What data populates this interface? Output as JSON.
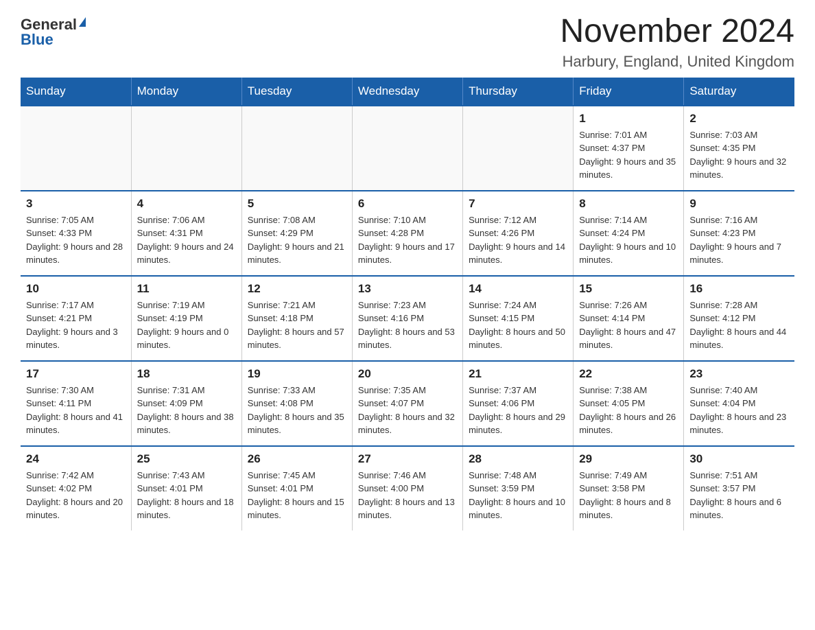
{
  "header": {
    "logo_general": "General",
    "logo_blue": "Blue",
    "month_title": "November 2024",
    "location": "Harbury, England, United Kingdom"
  },
  "weekdays": [
    "Sunday",
    "Monday",
    "Tuesday",
    "Wednesday",
    "Thursday",
    "Friday",
    "Saturday"
  ],
  "weeks": [
    [
      {
        "day": "",
        "info": ""
      },
      {
        "day": "",
        "info": ""
      },
      {
        "day": "",
        "info": ""
      },
      {
        "day": "",
        "info": ""
      },
      {
        "day": "",
        "info": ""
      },
      {
        "day": "1",
        "info": "Sunrise: 7:01 AM\nSunset: 4:37 PM\nDaylight: 9 hours and 35 minutes."
      },
      {
        "day": "2",
        "info": "Sunrise: 7:03 AM\nSunset: 4:35 PM\nDaylight: 9 hours and 32 minutes."
      }
    ],
    [
      {
        "day": "3",
        "info": "Sunrise: 7:05 AM\nSunset: 4:33 PM\nDaylight: 9 hours and 28 minutes."
      },
      {
        "day": "4",
        "info": "Sunrise: 7:06 AM\nSunset: 4:31 PM\nDaylight: 9 hours and 24 minutes."
      },
      {
        "day": "5",
        "info": "Sunrise: 7:08 AM\nSunset: 4:29 PM\nDaylight: 9 hours and 21 minutes."
      },
      {
        "day": "6",
        "info": "Sunrise: 7:10 AM\nSunset: 4:28 PM\nDaylight: 9 hours and 17 minutes."
      },
      {
        "day": "7",
        "info": "Sunrise: 7:12 AM\nSunset: 4:26 PM\nDaylight: 9 hours and 14 minutes."
      },
      {
        "day": "8",
        "info": "Sunrise: 7:14 AM\nSunset: 4:24 PM\nDaylight: 9 hours and 10 minutes."
      },
      {
        "day": "9",
        "info": "Sunrise: 7:16 AM\nSunset: 4:23 PM\nDaylight: 9 hours and 7 minutes."
      }
    ],
    [
      {
        "day": "10",
        "info": "Sunrise: 7:17 AM\nSunset: 4:21 PM\nDaylight: 9 hours and 3 minutes."
      },
      {
        "day": "11",
        "info": "Sunrise: 7:19 AM\nSunset: 4:19 PM\nDaylight: 9 hours and 0 minutes."
      },
      {
        "day": "12",
        "info": "Sunrise: 7:21 AM\nSunset: 4:18 PM\nDaylight: 8 hours and 57 minutes."
      },
      {
        "day": "13",
        "info": "Sunrise: 7:23 AM\nSunset: 4:16 PM\nDaylight: 8 hours and 53 minutes."
      },
      {
        "day": "14",
        "info": "Sunrise: 7:24 AM\nSunset: 4:15 PM\nDaylight: 8 hours and 50 minutes."
      },
      {
        "day": "15",
        "info": "Sunrise: 7:26 AM\nSunset: 4:14 PM\nDaylight: 8 hours and 47 minutes."
      },
      {
        "day": "16",
        "info": "Sunrise: 7:28 AM\nSunset: 4:12 PM\nDaylight: 8 hours and 44 minutes."
      }
    ],
    [
      {
        "day": "17",
        "info": "Sunrise: 7:30 AM\nSunset: 4:11 PM\nDaylight: 8 hours and 41 minutes."
      },
      {
        "day": "18",
        "info": "Sunrise: 7:31 AM\nSunset: 4:09 PM\nDaylight: 8 hours and 38 minutes."
      },
      {
        "day": "19",
        "info": "Sunrise: 7:33 AM\nSunset: 4:08 PM\nDaylight: 8 hours and 35 minutes."
      },
      {
        "day": "20",
        "info": "Sunrise: 7:35 AM\nSunset: 4:07 PM\nDaylight: 8 hours and 32 minutes."
      },
      {
        "day": "21",
        "info": "Sunrise: 7:37 AM\nSunset: 4:06 PM\nDaylight: 8 hours and 29 minutes."
      },
      {
        "day": "22",
        "info": "Sunrise: 7:38 AM\nSunset: 4:05 PM\nDaylight: 8 hours and 26 minutes."
      },
      {
        "day": "23",
        "info": "Sunrise: 7:40 AM\nSunset: 4:04 PM\nDaylight: 8 hours and 23 minutes."
      }
    ],
    [
      {
        "day": "24",
        "info": "Sunrise: 7:42 AM\nSunset: 4:02 PM\nDaylight: 8 hours and 20 minutes."
      },
      {
        "day": "25",
        "info": "Sunrise: 7:43 AM\nSunset: 4:01 PM\nDaylight: 8 hours and 18 minutes."
      },
      {
        "day": "26",
        "info": "Sunrise: 7:45 AM\nSunset: 4:01 PM\nDaylight: 8 hours and 15 minutes."
      },
      {
        "day": "27",
        "info": "Sunrise: 7:46 AM\nSunset: 4:00 PM\nDaylight: 8 hours and 13 minutes."
      },
      {
        "day": "28",
        "info": "Sunrise: 7:48 AM\nSunset: 3:59 PM\nDaylight: 8 hours and 10 minutes."
      },
      {
        "day": "29",
        "info": "Sunrise: 7:49 AM\nSunset: 3:58 PM\nDaylight: 8 hours and 8 minutes."
      },
      {
        "day": "30",
        "info": "Sunrise: 7:51 AM\nSunset: 3:57 PM\nDaylight: 8 hours and 6 minutes."
      }
    ]
  ]
}
